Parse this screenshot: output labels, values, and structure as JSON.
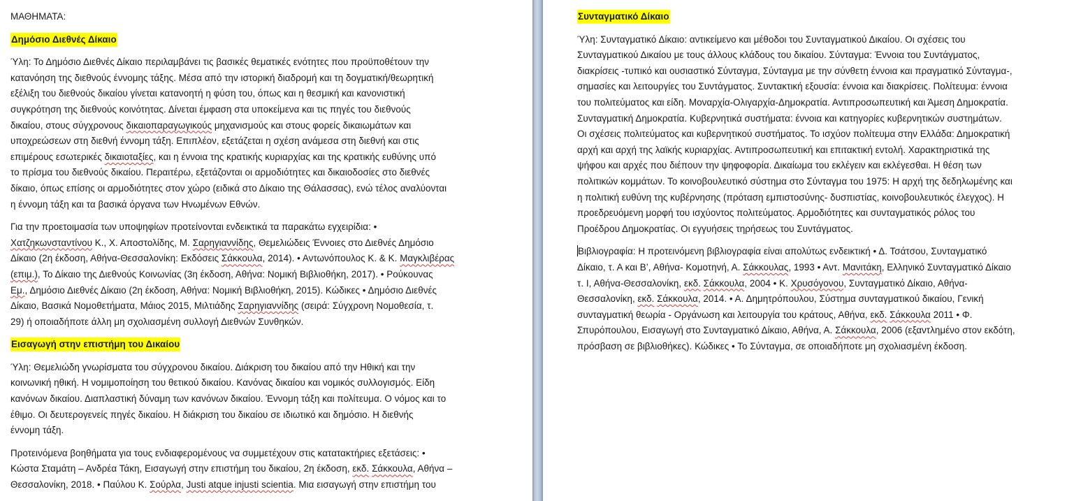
{
  "left_page": {
    "title": "ΜΑΘΗΜΑΤΑ:",
    "section1": {
      "heading": "Δημόσιο Διεθνές Δίκαιο",
      "p1": [
        "Ύλη: Το Δημόσιο Διεθνές Δίκαιο περιλαμβάνει τις βασικές θεματικές ενότητες που προϋποθέτουν την",
        "κατανόηση της διεθνούς έννομης τάξης. Μέσα από την ιστορική διαδρομή και τη δογματική/θεωρητική",
        "εξέλιξη του διεθνούς δικαίου γίνεται κατανοητή η φύση του, όπως και η θεσμική και κανονιστική",
        "συγκρότηση της διεθνούς κοινότητας. Δίνεται έμφαση στα υποκείμενα και τις πηγές του διεθνούς"
      ],
      "p1_l5_a": "δικαίου, στους σύγχρονους ",
      "p1_l5_sq": "δικαιοπαραγωγικούς",
      "p1_l5_b": " μηχανισμούς και στους φορείς δικαιωμάτων και",
      "p1_l6": "υποχρεώσεων στη διεθνή έννομη τάξη. Επιπλέον, εξετάζεται η σχέση ανάμεσα στη διεθνή και στις",
      "p1_l7_a": "επιμέρους εσωτερικές ",
      "p1_l7_sq": "δικαιοταξίες",
      "p1_l7_b": ", και η έννοια της κρατικής κυριαρχίας και της κρατικής ευθύνης υπό",
      "p1_rest": [
        "το πρίσμα του διεθνούς δικαίου. Περαιτέρω, εξετάζονται οι αρμοδιότητες και δικαιοδοσίες στο διεθνές",
        "δίκαιο, όπως επίσης οι αρμοδιότητες στον χώρο (ειδικά στο Δίκαιο της Θάλασσας), ενώ τέλος αναλύονται",
        "η έννομη τάξη και τα βασικά όργανα των Ηνωμένων Εθνών."
      ],
      "p2_l1": "Για την προετοιμασία των υποψηφίων προτείνονται ενδεικτικά τα παρακάτω εγχειρίδια: •",
      "p2_l2_sq1": "Χατζηκωνσταντίνου",
      "p2_l2_a": " Κ., Χ. Αποστολίδης, Μ. ",
      "p2_l2_sq2": "Σαρηγιαννίδης",
      "p2_l2_b": ", Θεμελιώδεις Έννοιες στο Διεθνές Δημόσιο",
      "p2_l3_a": "Δίκαιο (2η έκδοση, Αθήνα-Θεσσαλονίκη: Εκδόσεις ",
      "p2_l3_sq": "Σάκκουλα",
      "p2_l3_b": ", 2014). • Αντωνόπουλος Κ. & Κ. ",
      "p2_l3_sq2": "Μαγκλιβέρας",
      "p2_l4_sq": "(επιμ.)",
      "p2_l4_b": ", Το Δίκαιο της Διεθνούς Κοινωνίας (3η έκδοση, Αθήνα: Νομική Βιβλιοθήκη, 2017). • Ρούκουνας",
      "p2_l5_sq": "Εμ.",
      "p2_l5_b": ", Δημόσιο Διεθνές Δίκαιο (2η έκδοση, Αθήνα: Νομική Βιβλιοθήκη, 2015). Κώδικες • Δημόσιο Διεθνές",
      "p2_l6_a": "Δίκαιο, Βασικά Νομοθετήματα, Μάιος 2015, Μιλτιάδης ",
      "p2_l6_sq": "Σαρηγιαννίδης",
      "p2_l6_b": " (σειρά: Σύγχρονη Νομοθεσία, τ.",
      "p2_l7": "29) ή οποιαδήποτε άλλη μη σχολιασμένη συλλογή Διεθνών Συνθηκών."
    },
    "section2": {
      "heading": "Εισαγωγή στην επιστήμη του Δικαίου",
      "p1": [
        "Ύλη: Θεμελιώδη γνωρίσματα του σύγχρονου δικαίου. Διάκριση του δικαίου από την Ηθική και την",
        "κοινωνική ηθική. Η νομιμοποίηση του θετικού δικαίου. Κανόνας δικαίου και νομικός συλλογισμός. Είδη",
        "κανόνων δικαίου. Διαπλαστική δύναμη των κανόνων δικαίου. Έννομη τάξη και πολίτευμα. Ο νόμος και το",
        "έθιμο. Οι δευτερογενείς πηγές δικαίου. Η διάκριση του δικαίου σε ιδιωτικό και δημόσιο. Η διεθνής",
        "έννομη τάξη."
      ],
      "p2_l1": "Προτεινόμενα βοηθήματα για τους ενδιαφερομένους να συμμετέχουν στις κατατακτήριες εξετάσεις: •",
      "p2_l2_a": "Κώστα Σταμάτη – Ανδρέα Τάκη, Εισαγωγή στην επιστήμη του δικαίου, 2η έκδοση, ",
      "p2_l2_sq1": "εκδ.",
      "p2_l2_sp": " ",
      "p2_l2_sq2": "Σάκκουλα",
      "p2_l2_b": ", Αθήνα –",
      "p2_l3_a": "Θεσσαλονίκη, 2018. • Παύλου Κ. ",
      "p2_l3_sq1": "Σούρλα",
      "p2_l3_c": ", ",
      "p2_l3_sq2": "Justi atque injusti scientia",
      "p2_l3_b": ". Μια εισαγωγή στην επιστήμη του"
    }
  },
  "right_page": {
    "heading": "Συνταγματικό Δίκαιο",
    "p1": [
      "Ύλη: Συνταγματικό Δίκαιο: αντικείμενο και μέθοδοι του Συνταγματικού Δικαίου. Οι σχέσεις του",
      "Συνταγματικού Δικαίου με τους άλλους κλάδους του δικαίου. Σύνταγμα: Έννοια του Συντάγματος,",
      "διακρίσεις -τυπικό και ουσιαστικό Σύνταγμα, Σύνταγμα με την σύνθετη έννοια και πραγματικό Σύνταγμα-,",
      "σημασίες και λειτουργίες του Συντάγματος. Συντακτική εξουσία: έννοια και διακρίσεις. Πολίτευμα: έννοια",
      "του πολιτεύματος και είδη. Μοναρχία-Ολιγαρχία-Δημοκρατία. Αντιπροσωπευτική και Άμεση Δημοκρατία.",
      "Συνταγματική Δημοκρατία. Κυβερνητικά συστήματα: έννοια και κατηγορίες κυβερνητικών συστημάτων.",
      "Οι σχέσεις πολιτεύματος και κυβερνητικού συστήματος. Το ισχύον πολίτευμα στην Ελλάδα: Δημοκρατική",
      "αρχή και αρχή της λαϊκής κυριαρχίας. Αντιπροσωπευτική και επιτακτική εντολή. Χαρακτηριστικά της",
      "ψήφου και αρχές που διέπουν την ψηφοφορία. Δικαίωμα του εκλέγειν και εκλέγεσθαι. Η θέση των",
      "πολιτικών κομμάτων. Το κοινοβουλευτικό σύστημα στο Σύνταγμα του 1975: Η αρχή της δεδηλωμένης και",
      "η πολιτική ευθύνη της κυβέρνησης (πρόταση εμπιστοσύνης- δυσπιστίας, κοινοβουλευτικός έλεγχος). Η",
      "προεδρευόμενη μορφή του ισχύοντος πολιτεύματος. Αρμοδιότητες και συνταγματικός ρόλος του",
      "Προέδρου Δημοκρατίας. Οι εγγυήσεις τηρήσεως του Συντάγματος."
    ],
    "p2_l1": "Βιβλιογραφία: Η προτεινόμενη βιβλιογραφία είναι απολύτως ενδεικτική • Δ. Τσάτσου, Συνταγματικό",
    "p2_l2_a": "Δίκαιο, τ. Α και Β’, Αθήνα- Κομοτηνή, Α. ",
    "p2_l2_sq": "Σάκκουλας",
    "p2_l2_b": ", 1993 • Αντ. ",
    "p2_l2_sq2": "Μανιτάκη",
    "p2_l2_c": ", Ελληνικό Συνταγματικό Δίκαιο",
    "p2_l3_a": "τ. Ι, Αθήνα-Θεσσαλονίκη, ",
    "p2_l3_sq1": "εκδ.",
    "p2_l3_sp": " ",
    "p2_l3_sq2": "Σάκκουλα",
    "p2_l3_b": ", 2004 • Κ. ",
    "p2_l3_sq3": "Χρυσόγονου",
    "p2_l3_c": ", Συνταγματικό Δίκαιο, Αθήνα-",
    "p2_l4_a": "Θεσσαλονίκη, ",
    "p2_l4_sq1": "εκδ.",
    "p2_l4_sp": " ",
    "p2_l4_sq2": "Σάκκουλα",
    "p2_l4_b": ", 2014. • Α. Δημητρόπουλου, Σύστημα συνταγματικού δικαίου, Γενική",
    "p2_l5_a": "συνταγματική θεωρία - Οργάνωση και λειτουργία του κράτους, Αθήνα, ",
    "p2_l5_sq1": "εκδ.",
    "p2_l5_sp": " ",
    "p2_l5_sq2": "Σάκκουλα",
    "p2_l5_b": " 2011 • Φ.",
    "p2_l6_a": "Σπυρόπουλου, Εισαγωγή στο Συνταγματικό Δίκαιο, Αθήνα, Α. ",
    "p2_l6_sq": "Σάκκουλα",
    "p2_l6_b": ", 2006 (εξαντλημένο στον εκδότη,",
    "p2_l7": "πρόσβαση σε βιβλιοθήκες). Κώδικες • Το Σύνταγμα, σε οποιαδήποτε μη σχολιασμένη έκδοση."
  }
}
